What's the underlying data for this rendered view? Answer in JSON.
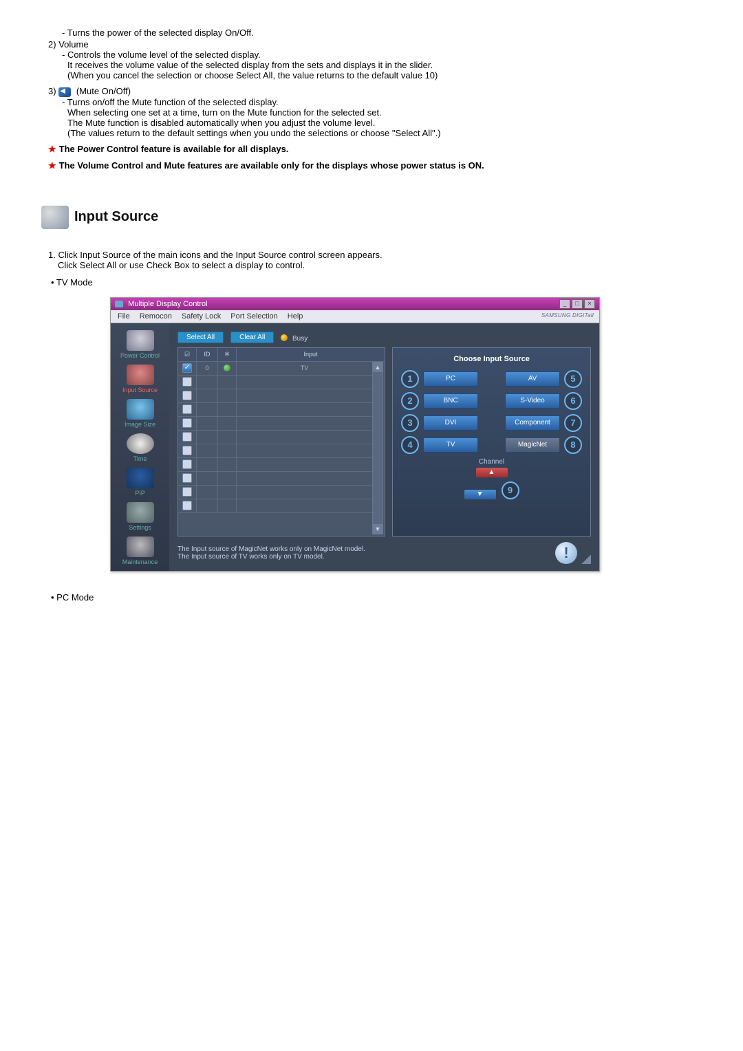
{
  "top_list": {
    "item1_desc": "- Turns the power of the selected display On/Off.",
    "item2_num": "2)",
    "item2_label": "Volume",
    "item2_d1": "- Controls the volume level of the selected display.",
    "item2_d2": "It receives the volume value of the selected display from the sets and displays it in the slider.",
    "item2_d3": "(When you cancel the selection or choose Select All, the value returns to the default value 10)",
    "item3_num": "3)",
    "item3_label": "(Mute On/Off)",
    "item3_d1": "- Turns on/off the Mute function of the selected display.",
    "item3_d2": "When selecting one set at a time, turn on the Mute function for the selected set.",
    "item3_d3": "The Mute function is disabled automatically when you adjust the volume level.",
    "item3_d4": "(The values return to the default settings when you undo the selections or choose \"Select All\".)",
    "note1": "The Power Control feature is available for all displays.",
    "note2": "The Volume Control and Mute features are available only for the displays whose power status is ON."
  },
  "section": {
    "title": "Input Source",
    "step_num": "1.",
    "step_a": "Click Input Source of the main icons and the Input Source control screen appears.",
    "step_b": "Click Select All or use Check Box to select a display to control.",
    "mode_tv": "• TV Mode",
    "mode_pc": "• PC Mode"
  },
  "app": {
    "title": "Multiple Display Control",
    "menu": [
      "File",
      "Remocon",
      "Safety Lock",
      "Port Selection",
      "Help"
    ],
    "brand": "SAMSUNG DIGITall",
    "sidebar": [
      {
        "label": "Power Control"
      },
      {
        "label": "Input Source"
      },
      {
        "label": "Image Size"
      },
      {
        "label": "Time"
      },
      {
        "label": "PIP"
      },
      {
        "label": "Settings"
      },
      {
        "label": "Maintenance"
      }
    ],
    "toolbar": {
      "select_all": "Select All",
      "clear_all": "Clear All",
      "busy": "Busy"
    },
    "grid": {
      "headers": {
        "chk": "☑",
        "id": "ID",
        "status": "※",
        "input": "Input"
      },
      "rows": [
        {
          "checked": true,
          "id": "0",
          "status": "green",
          "input": "TV"
        },
        {
          "checked": false,
          "id": "",
          "status": "",
          "input": ""
        },
        {
          "checked": false,
          "id": "",
          "status": "",
          "input": ""
        },
        {
          "checked": false,
          "id": "",
          "status": "",
          "input": ""
        },
        {
          "checked": false,
          "id": "",
          "status": "",
          "input": ""
        },
        {
          "checked": false,
          "id": "",
          "status": "",
          "input": ""
        },
        {
          "checked": false,
          "id": "",
          "status": "",
          "input": ""
        },
        {
          "checked": false,
          "id": "",
          "status": "",
          "input": ""
        },
        {
          "checked": false,
          "id": "",
          "status": "",
          "input": ""
        },
        {
          "checked": false,
          "id": "",
          "status": "",
          "input": ""
        },
        {
          "checked": false,
          "id": "",
          "status": "",
          "input": ""
        }
      ]
    },
    "panel": {
      "title": "Choose Input Source",
      "left": [
        "PC",
        "BNC",
        "DVI",
        "TV"
      ],
      "right": [
        "AV",
        "S-Video",
        "Component",
        "MagicNet"
      ],
      "left_nums": [
        "1",
        "2",
        "3",
        "4"
      ],
      "right_nums": [
        "5",
        "6",
        "7",
        "8"
      ],
      "channel_label": "Channel",
      "nine": "9"
    },
    "footer": {
      "line1": "The Input source of MagicNet works only on MagicNet model.",
      "line2": "The Input source of TV works only on TV  model."
    }
  },
  "chart_data": {
    "type": "table",
    "title": "Display list",
    "columns": [
      "☑",
      "ID",
      "※",
      "Input"
    ],
    "rows": [
      [
        "checked",
        "0",
        "green",
        "TV"
      ]
    ]
  }
}
